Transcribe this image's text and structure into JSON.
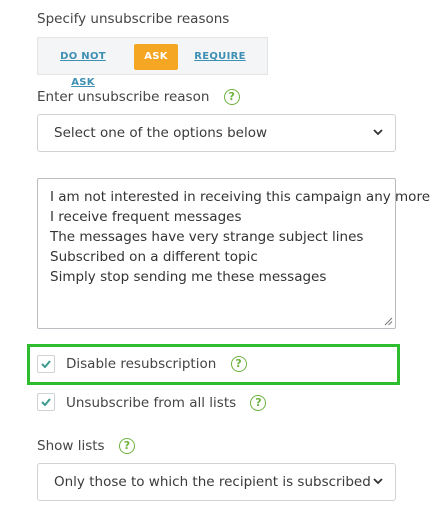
{
  "unsubscribe_reasons": {
    "title": "Specify unsubscribe reasons",
    "options": [
      {
        "label": "DO NOT ASK",
        "active": false
      },
      {
        "label": "ASK",
        "active": true
      },
      {
        "label": "REQUIRE",
        "active": false
      }
    ]
  },
  "reason_input": {
    "label": "Enter unsubscribe reason",
    "help": "?",
    "selected": "Select one of the options below"
  },
  "reasons_text": {
    "lines": [
      "I am not interested in receiving this campaign any more",
      "I receive frequent messages",
      "The messages have very strange subject lines",
      "Subscribed on a different topic",
      "Simply stop sending me these messages"
    ]
  },
  "disable_resubscription": {
    "label": "Disable resubscription",
    "checked": true,
    "help": "?"
  },
  "unsubscribe_all": {
    "label": "Unsubscribe from all lists",
    "checked": true,
    "help": "?"
  },
  "show_lists": {
    "label": "Show lists",
    "help": "?",
    "selected": "Only those to which the recipient is subscribed"
  },
  "colors": {
    "accent": "#f5a623",
    "link": "#3d8fb3",
    "help": "#6cb33f",
    "highlight": "#2ebd2e",
    "check": "#3d9b8f"
  }
}
